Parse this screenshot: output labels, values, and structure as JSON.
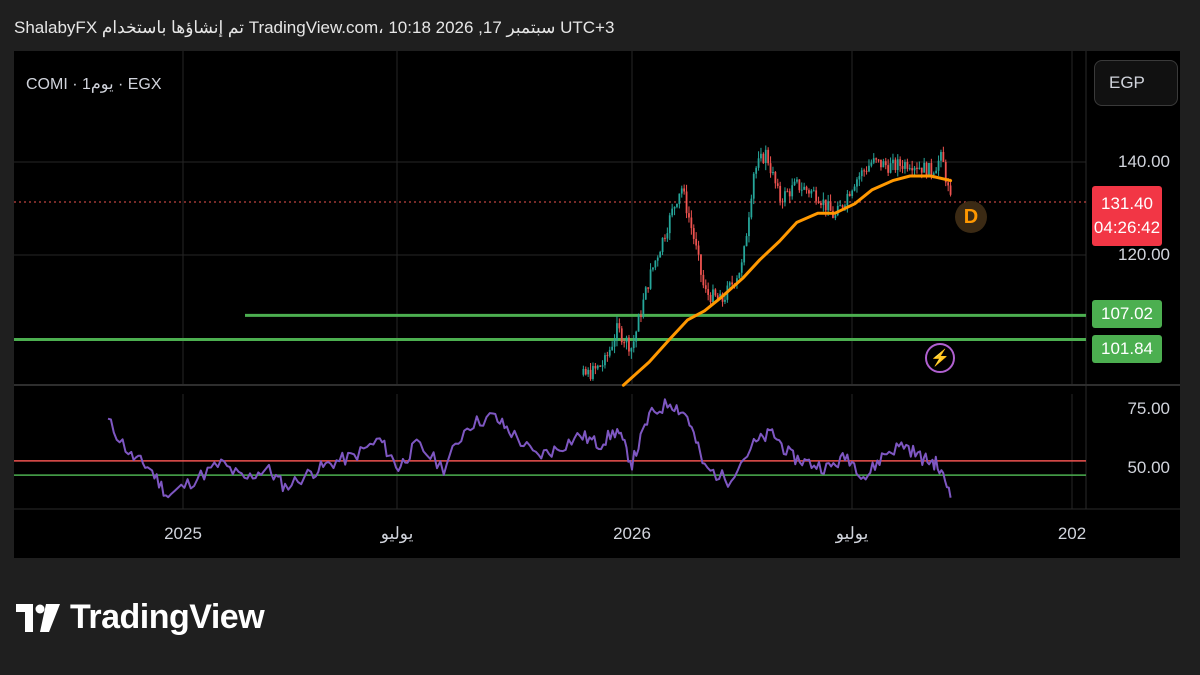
{
  "header": {
    "text": "ShalabyFX تم إنشاؤها باستخدام TradingView.com، 10:18 2026 ,17 سبتمبر UTC+3"
  },
  "symbol": {
    "text": "COMI · 1يوم · EGX"
  },
  "currency_button": "EGP",
  "price_axis": {
    "ticks": [
      "140.00",
      "120.00"
    ],
    "current_price": "131.40",
    "countdown": "04:26:42",
    "levels": [
      "107.02",
      "101.84"
    ]
  },
  "rsi_axis": {
    "ticks": [
      "75.00",
      "50.00"
    ]
  },
  "time_axis": [
    "2025",
    "يوليو",
    "2026",
    "يوليو",
    "202"
  ],
  "markers": {
    "dividend": "D"
  },
  "footer": {
    "brand": "TradingView"
  },
  "colors": {
    "up": "#26a69a",
    "down": "#ef5350",
    "ma": "#ff9800",
    "rsi": "#7e57c2",
    "level": "#4caf50",
    "price_box": "#f23645"
  },
  "chart_data": [
    {
      "type": "candlestick",
      "symbol": "COMI",
      "exchange": "EGX",
      "interval": "1D",
      "currency": "EGP",
      "last_price": 131.4,
      "horizontal_levels": [
        107.02,
        101.84
      ],
      "price_series": {
        "name": "",
        "x": [
          "2025-11-01",
          "2025-11-15",
          "2025-12-01",
          "2025-12-10",
          "2025-12-20",
          "2026-01-01",
          "2026-01-15",
          "2026-02-01",
          "2026-02-10",
          "2026-02-20",
          "2026-03-01",
          "2026-03-15",
          "2026-04-01",
          "2026-04-10",
          "2026-04-20",
          "2026-05-01",
          "2026-05-15",
          "2026-06-01",
          "2026-06-15",
          "2026-07-01",
          "2026-07-15",
          "2026-08-01",
          "2026-08-15",
          "2026-09-01",
          "2026-09-10",
          "2026-09-17"
        ],
        "values": [
          92,
          93,
          95,
          97,
          104,
          100,
          115,
          128,
          135,
          124,
          112,
          110,
          118,
          138,
          142,
          132,
          135,
          133,
          128,
          136,
          140,
          139,
          140,
          138,
          141,
          131.4
        ]
      },
      "moving_average": {
        "x": [
          "2025-12-25",
          "2026-01-15",
          "2026-02-01",
          "2026-02-15",
          "2026-03-01",
          "2026-03-15",
          "2026-04-01",
          "2026-04-15",
          "2026-05-01",
          "2026-05-15",
          "2026-06-01",
          "2026-06-15",
          "2026-07-01",
          "2026-07-15",
          "2026-08-01",
          "2026-08-15",
          "2026-09-01",
          "2026-09-17"
        ],
        "values": [
          92,
          97,
          102,
          106,
          108,
          111,
          115,
          119,
          123,
          127,
          129,
          129,
          131,
          134,
          136,
          137,
          137,
          136
        ]
      }
    },
    {
      "type": "line",
      "name": "",
      "x": [
        "2024-11-01",
        "2024-11-20",
        "2024-12-05",
        "2024-12-20",
        "2025-01-10",
        "2025-02-01",
        "2025-02-20",
        "2025-03-10",
        "2025-03-25",
        "2025-04-15",
        "2025-05-01",
        "2025-05-20",
        "2025-06-10",
        "2025-06-25",
        "2025-07-10",
        "2025-08-01",
        "2025-08-20",
        "2025-09-10",
        "2025-09-25",
        "2025-10-15",
        "2025-11-01",
        "2025-11-20",
        "2025-12-05",
        "2025-12-20",
        "2026-01-01",
        "2026-01-15",
        "2026-02-01",
        "2026-02-15",
        "2026-03-01",
        "2026-03-20",
        "2026-04-10",
        "2026-04-25",
        "2026-05-10",
        "2026-05-25",
        "2026-06-10",
        "2026-06-25",
        "2026-07-10",
        "2026-07-25",
        "2026-08-10",
        "2026-08-25",
        "2026-09-05",
        "2026-09-17"
      ],
      "values": [
        70,
        55,
        50,
        38,
        45,
        52,
        45,
        50,
        42,
        48,
        52,
        55,
        62,
        50,
        60,
        50,
        68,
        72,
        65,
        55,
        58,
        64,
        60,
        66,
        52,
        72,
        78,
        72,
        50,
        45,
        60,
        65,
        55,
        52,
        50,
        55,
        46,
        56,
        60,
        54,
        52,
        40
      ],
      "upper_band": 53,
      "lower_band": 47,
      "ylim": [
        35,
        80
      ]
    }
  ]
}
